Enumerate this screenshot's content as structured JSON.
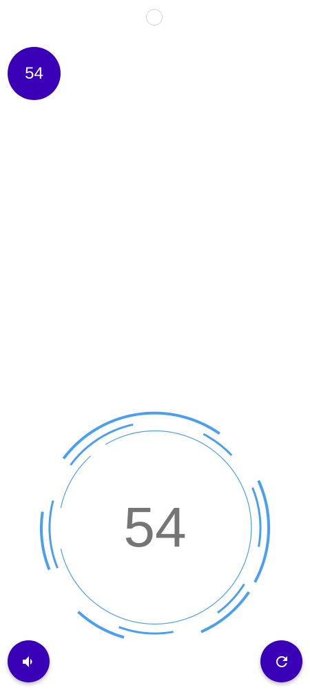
{
  "header": {
    "count_badge": "54"
  },
  "timer": {
    "value": "54"
  },
  "controls": {
    "sound_icon": "volume-icon",
    "reset_icon": "refresh-icon"
  },
  "colors": {
    "primary": "#3a00b7",
    "ring": "#4a9ff0",
    "timer_text": "#757575"
  }
}
